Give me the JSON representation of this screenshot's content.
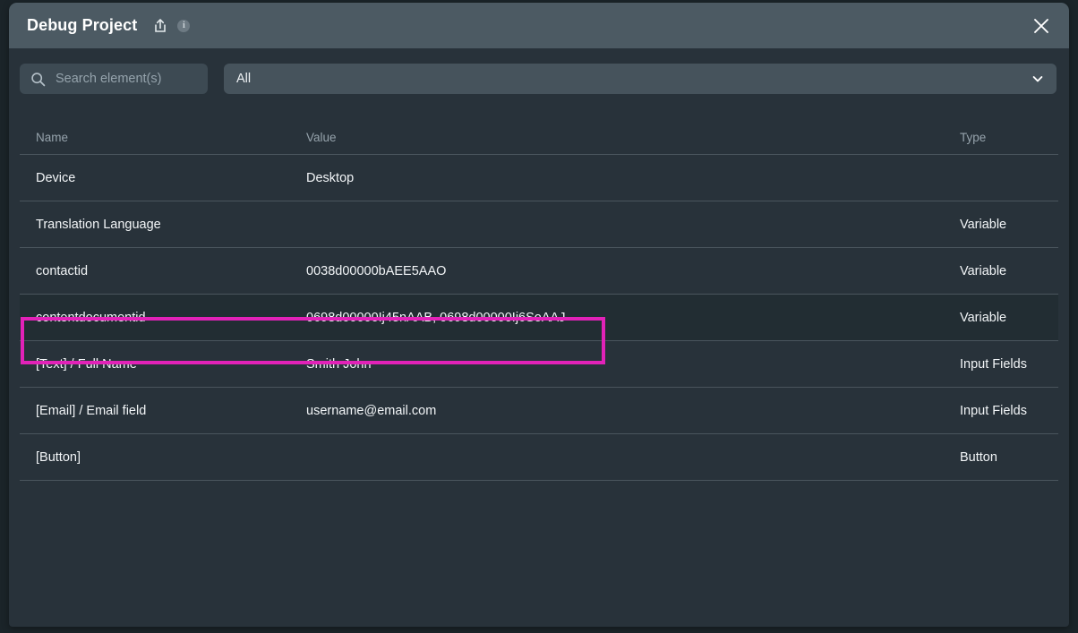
{
  "window": {
    "title": "Debug Project",
    "share_icon": "share-icon",
    "info_icon": "info-icon",
    "close_icon": "close-icon"
  },
  "toolbar": {
    "search": {
      "icon": "search-icon",
      "placeholder": "Search element(s)",
      "value": ""
    },
    "filter": {
      "selected": "All",
      "icon": "chevron-down-icon"
    }
  },
  "table": {
    "columns": [
      "Name",
      "Value",
      "Type"
    ],
    "rows": [
      {
        "name": "Device",
        "value": "Desktop",
        "type": "",
        "highlighted": false
      },
      {
        "name": "Translation Language",
        "value": "",
        "type": "Variable",
        "highlighted": false
      },
      {
        "name": "contactid",
        "value": "0038d00000bAEE5AAO",
        "type": "Variable",
        "highlighted": false
      },
      {
        "name": "contentdocumentid",
        "value": "0698d00000Ij45nAAB, 0698d00000Ij6SoAAJ",
        "type": "Variable",
        "highlighted": true
      },
      {
        "name": "[Text] / Full Name",
        "value": "Smith John",
        "type": "Input Fields",
        "highlighted": false
      },
      {
        "name": "[Email] / Email field",
        "value": "username@email.com",
        "type": "Input Fields",
        "highlighted": false
      },
      {
        "name": "[Button]",
        "value": "",
        "type": "Button",
        "highlighted": false
      }
    ]
  },
  "annotation": {
    "color": "#e222b8",
    "target_row": "contentdocumentid"
  }
}
